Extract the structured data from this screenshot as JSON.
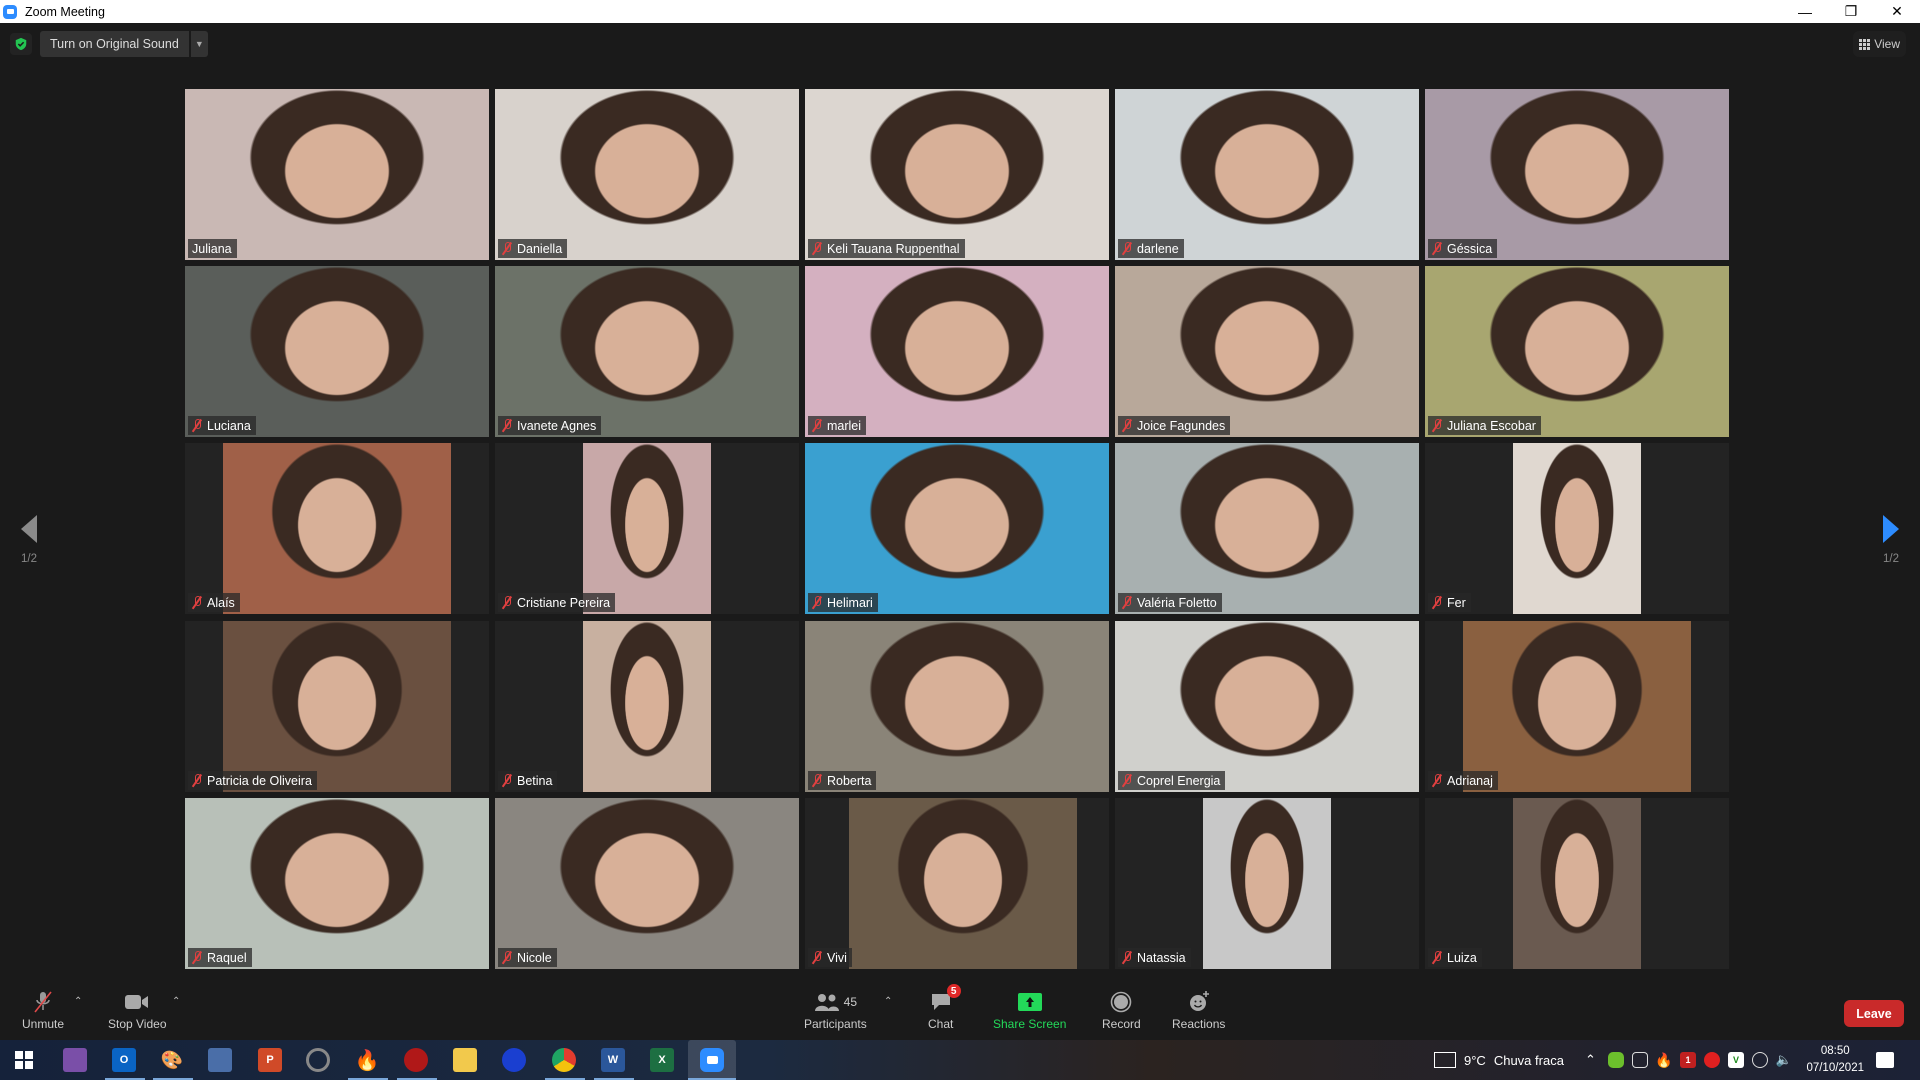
{
  "window": {
    "title": "Zoom Meeting",
    "controls": [
      "minimize",
      "restore",
      "close"
    ]
  },
  "topbar": {
    "security_icon": "shield-check-icon",
    "original_sound_label": "Turn on Original Sound",
    "view_label": "View"
  },
  "gallery": {
    "page_left": "1/2",
    "page_right": "1/2",
    "active_speaker": "Juliana",
    "participants": [
      {
        "name": "Juliana",
        "muted": false,
        "active": true
      },
      {
        "name": "Daniella",
        "muted": true
      },
      {
        "name": "Keli Tauana Ruppenthal",
        "muted": true
      },
      {
        "name": "darlene",
        "muted": true
      },
      {
        "name": "Géssica",
        "muted": true
      },
      {
        "name": "Luciana",
        "muted": true
      },
      {
        "name": "Ivanete Agnes",
        "muted": true
      },
      {
        "name": "marlei",
        "muted": true
      },
      {
        "name": "Joice Fagundes",
        "muted": true
      },
      {
        "name": "Juliana Escobar",
        "muted": true
      },
      {
        "name": "Alaís",
        "muted": true
      },
      {
        "name": "Cristiane Pereira",
        "muted": true
      },
      {
        "name": "Helimari",
        "muted": true
      },
      {
        "name": "Valéria Foletto",
        "muted": true
      },
      {
        "name": "Fer",
        "muted": true
      },
      {
        "name": "Patricia de Oliveira",
        "muted": true
      },
      {
        "name": "Betina",
        "muted": true
      },
      {
        "name": "Roberta",
        "muted": true
      },
      {
        "name": "Coprel Energia",
        "muted": true
      },
      {
        "name": "Adrianaj",
        "muted": true
      },
      {
        "name": "Raquel",
        "muted": true
      },
      {
        "name": "Nicole",
        "muted": true
      },
      {
        "name": "Vivi",
        "muted": true
      },
      {
        "name": "Natassia",
        "muted": true
      },
      {
        "name": "Luiza",
        "muted": true
      }
    ]
  },
  "toolbar": {
    "unmute": "Unmute",
    "stop_video": "Stop Video",
    "participants": "Participants",
    "participants_count": "45",
    "chat": "Chat",
    "chat_badge": "5",
    "share_screen": "Share Screen",
    "record": "Record",
    "reactions": "Reactions",
    "leave": "Leave",
    "colors": {
      "share": "#23d959",
      "leave": "#c92a2a",
      "badge": "#e02828"
    }
  },
  "taskbar": {
    "apps": [
      "start",
      "app-purple",
      "outlook",
      "paint",
      "movie-maker",
      "powerpoint",
      "app-arc",
      "app-flame",
      "app-red",
      "file-explorer",
      "app-headphones",
      "chrome",
      "word",
      "excel",
      "zoom"
    ],
    "weather_temp": "9°C",
    "weather_desc": "Chuva fraca",
    "time": "08:50",
    "date": "07/10/2021"
  }
}
